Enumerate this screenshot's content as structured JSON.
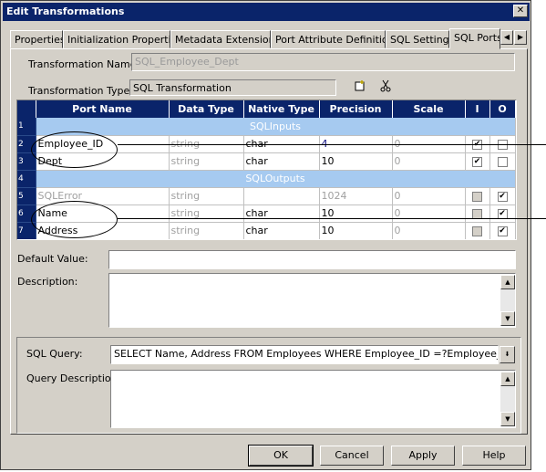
{
  "window": {
    "title": "Edit Transformations",
    "close_glyph": "✕"
  },
  "tabs": [
    "Properties",
    "Initialization Properties",
    "Metadata Extensions",
    "Port Attribute Definitions",
    "SQL Settings",
    "SQL Ports"
  ],
  "tab_scroll": {
    "left": "◀",
    "right": "▶"
  },
  "form": {
    "name_label": "Transformation Name:",
    "name_value": "SQL_Employee_Dept",
    "type_label": "Transformation Type:",
    "type_value": "SQL Transformation"
  },
  "toolbar_icons": [
    "new-port-icon",
    "cut-icon"
  ],
  "grid": {
    "headers": [
      "Port Name",
      "Data Type",
      "Native Type",
      "Precision",
      "Scale",
      "I",
      "O"
    ],
    "rows": [
      {
        "num": "1",
        "group": "SQLInputs"
      },
      {
        "num": "2",
        "name": "Employee_ID",
        "dtype": "string",
        "native": "char",
        "precision": "4",
        "scale": "0",
        "i": "checked",
        "o": "unchecked"
      },
      {
        "num": "3",
        "name": "Dept",
        "dtype": "string",
        "native": "char",
        "precision": "10",
        "scale": "0",
        "i": "checked",
        "o": "unchecked"
      },
      {
        "num": "4",
        "group": "SQLOutputs"
      },
      {
        "num": "5",
        "name": "SQLError",
        "dtype": "string",
        "native": "",
        "precision": "1024",
        "scale": "0",
        "i": "disabled",
        "o": "checked",
        "disabled": true
      },
      {
        "num": "6",
        "name": "Name",
        "dtype": "string",
        "native": "char",
        "precision": "10",
        "scale": "0",
        "i": "disabled",
        "o": "checked"
      },
      {
        "num": "7",
        "name": "Address",
        "dtype": "string",
        "native": "char",
        "precision": "10",
        "scale": "0",
        "i": "disabled",
        "o": "checked"
      }
    ]
  },
  "default_value": {
    "label": "Default Value:",
    "value": ""
  },
  "description": {
    "label": "Description:",
    "value": ""
  },
  "sql_query": {
    "label": "SQL Query:",
    "value": "SELECT Name, Address FROM Employees WHERE Employee_ID =?Employee_ID? and Dept"
  },
  "query_description": {
    "label": "Query Description:",
    "value": ""
  },
  "buttons": {
    "ok": "OK",
    "cancel": "Cancel",
    "apply": "Apply",
    "help": "Help"
  }
}
